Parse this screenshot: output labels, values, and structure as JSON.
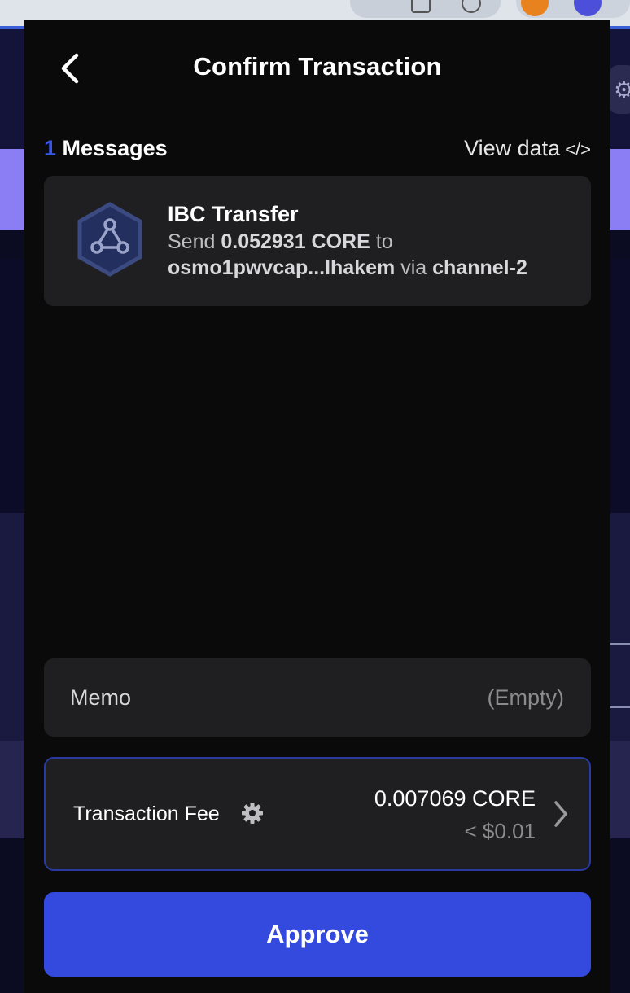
{
  "header": {
    "title": "Confirm Transaction"
  },
  "messages": {
    "count": "1",
    "label": "Messages",
    "view_data_label": "View data",
    "items": [
      {
        "title": "IBC Transfer",
        "send_word": "Send",
        "amount": "0.052931 CORE",
        "to_word": "to",
        "recipient": "osmo1pwvcap...lhakem",
        "via_word": "via",
        "channel": "channel-2"
      }
    ]
  },
  "memo": {
    "label": "Memo",
    "value": "(Empty)"
  },
  "fee": {
    "label": "Transaction Fee",
    "amount": "0.007069 CORE",
    "usd": "< $0.01"
  },
  "approve_label": "Approve",
  "colors": {
    "accent": "#3449de",
    "popup_bg": "#0a0a0a",
    "card_bg": "#1f1f21",
    "count_color": "#3b55e6"
  }
}
